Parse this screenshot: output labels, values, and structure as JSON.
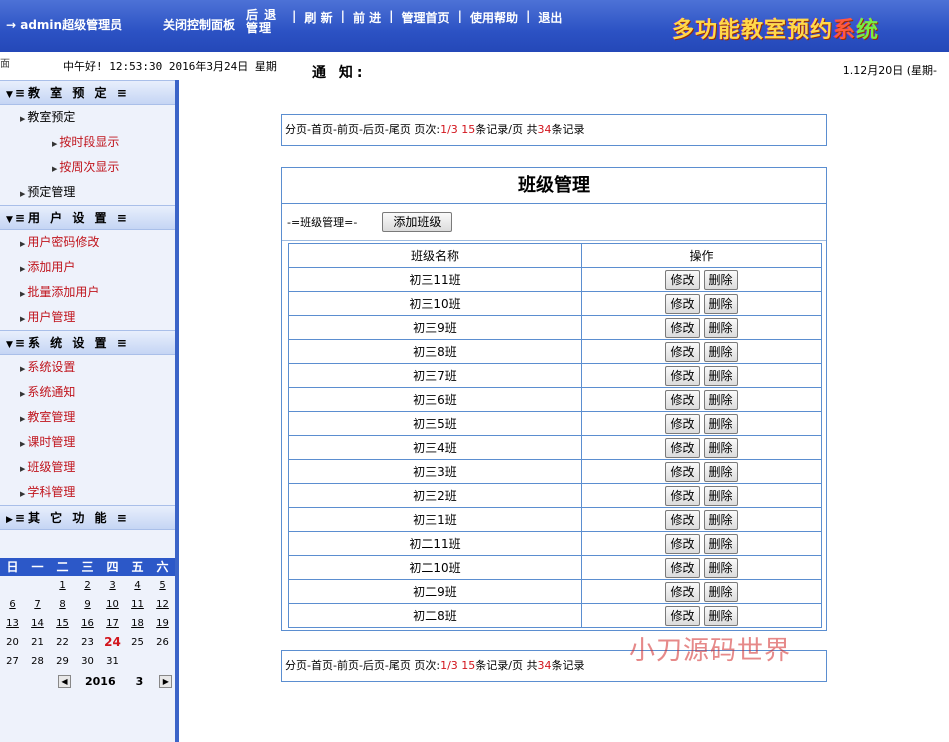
{
  "topbar": {
    "user": "→ admin超级管理员",
    "close_panel": "关闭控制面板",
    "nav": [
      {
        "label": "后 退 管理"
      },
      {
        "label": "刷 新"
      },
      {
        "label": "前 进"
      },
      {
        "label": "管理首页"
      },
      {
        "label": "使用帮助"
      },
      {
        "label": "退出"
      }
    ],
    "separator": "|",
    "logo": {
      "part1": "多功能教室预约",
      "part2": "系",
      "part3": "统"
    }
  },
  "infobar": {
    "mark": "面",
    "greeting": "中午好! 12:53:30  2016年3月24日 星期",
    "notice_title": "通 知:",
    "marquee": "1.12月20日 (星期-"
  },
  "sidebar": {
    "sections": [
      {
        "title": "≡教 室 预 定 ≡",
        "items": [
          {
            "label": "教室预定",
            "color": "black",
            "sub": false
          },
          {
            "label": "按时段显示",
            "color": "red",
            "sub": true
          },
          {
            "label": "按周次显示",
            "color": "red",
            "sub": true
          },
          {
            "label": "预定管理",
            "color": "black",
            "sub": false
          }
        ]
      },
      {
        "title": "≡用 户 设 置 ≡",
        "items": [
          {
            "label": "用户密码修改",
            "color": "red",
            "sub": false
          },
          {
            "label": "添加用户",
            "color": "red",
            "sub": false
          },
          {
            "label": "批量添加用户",
            "color": "red",
            "sub": false
          },
          {
            "label": "用户管理",
            "color": "red",
            "sub": false
          }
        ]
      },
      {
        "title": "≡系 统 设 置 ≡",
        "items": [
          {
            "label": "系统设置",
            "color": "red",
            "sub": false
          },
          {
            "label": "系统通知",
            "color": "red",
            "sub": false
          },
          {
            "label": "教室管理",
            "color": "red",
            "sub": false
          },
          {
            "label": "课时管理",
            "color": "red",
            "sub": false
          },
          {
            "label": "班级管理",
            "color": "red",
            "sub": false
          },
          {
            "label": "学科管理",
            "color": "red",
            "sub": false
          }
        ]
      },
      {
        "title": "≡其 它 功 能 ≡",
        "items": []
      }
    ]
  },
  "calendar": {
    "weekdays": [
      "日",
      "一",
      "二",
      "三",
      "四",
      "五",
      "六"
    ],
    "weeks": [
      [
        "",
        "",
        "1",
        "2",
        "3",
        "4",
        "5"
      ],
      [
        "6",
        "7",
        "8",
        "9",
        "10",
        "11",
        "12"
      ],
      [
        "13",
        "14",
        "15",
        "16",
        "17",
        "18",
        "19"
      ],
      [
        "20",
        "21",
        "22",
        "23",
        "24",
        "25",
        "26"
      ],
      [
        "27",
        "28",
        "29",
        "30",
        "31",
        "",
        ""
      ]
    ],
    "today": "24",
    "year": "2016",
    "month": "3",
    "prev": "◀",
    "next": "▶"
  },
  "pager": {
    "prefix": "分页-首页-前页-后页-尾页  页次:",
    "page": "1/3",
    "per_page": "15",
    "per_page_suffix": "条记录/页  共",
    "total": "34",
    "total_suffix": "条记录"
  },
  "panel": {
    "title": "班级管理",
    "toolbar_label": "-=班级管理=-",
    "add_button": "添加班级",
    "columns": [
      "班级名称",
      "操作"
    ],
    "edit_label": "修改",
    "delete_label": "删除",
    "rows": [
      "初三11班",
      "初三10班",
      "初三9班",
      "初三8班",
      "初三7班",
      "初三6班",
      "初三5班",
      "初三4班",
      "初三3班",
      "初三2班",
      "初三1班",
      "初二11班",
      "初二10班",
      "初二9班",
      "初二8班"
    ]
  },
  "watermark": "小刀源码世界",
  "colors": {
    "topbar": "#2c52c4",
    "sidebar_border": "#3b64c8",
    "border": "#5b8ed0",
    "accent_red": "#d2141c"
  }
}
